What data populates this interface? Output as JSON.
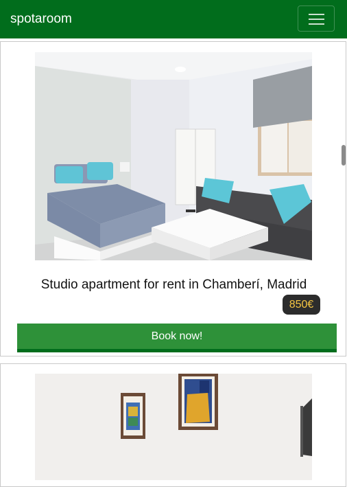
{
  "navbar": {
    "brand": "spotaroom",
    "toggler_icon": "hamburger-icon",
    "color": "#016d1c"
  },
  "listings": [
    {
      "title": "Studio apartment for rent in Chamberí, Madrid",
      "price": "850€",
      "button_label": "Book now!",
      "photo": "bedroom-living-room-photo"
    },
    {
      "photo": "room-with-paintings-photo"
    }
  ],
  "colors": {
    "button": "#2e9139",
    "price_badge": "#2c2c2c",
    "price_text": "#f5c542"
  }
}
